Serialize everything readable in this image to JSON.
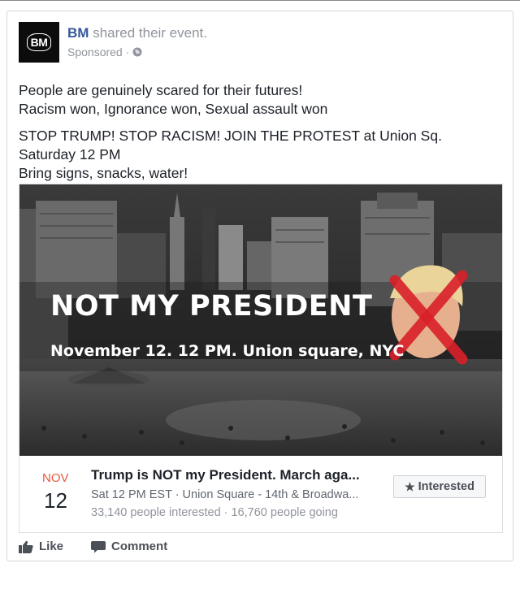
{
  "post": {
    "avatar_text": "BM",
    "author": "BM",
    "action": "shared their event.",
    "sponsored": "Sponsored ·",
    "text": {
      "p1_line1": "People are genuinely scared for their futures!",
      "p1_line2": "Racism won, Ignorance won, Sexual assault won",
      "p2_line1": "STOP TRUMP! STOP RACISM! JOIN THE PROTEST at Union Sq.",
      "p2_line2": "Saturday 12 PM",
      "p2_line3": "Bring signs, snacks, water!"
    }
  },
  "event_image": {
    "headline": "NOT MY PRESIDENT",
    "subline": "November 12. 12 PM. Union square, NYC"
  },
  "event": {
    "month": "NOV",
    "day": "12",
    "title": "Trump is NOT my President. March aga...",
    "meta": "Sat 12 PM EST · Union Square - 14th & Broadwa...",
    "stats": "33,140 people interested · 16,760 people going",
    "interested_label": "Interested",
    "interested_icon": "star-icon"
  },
  "actions": {
    "like_label": "Like",
    "like_icon": "thumbs-up-icon",
    "comment_label": "Comment",
    "comment_icon": "comment-icon"
  },
  "colors": {
    "author": "#365899",
    "month": "#e9573f",
    "cross": "#d9202a"
  }
}
